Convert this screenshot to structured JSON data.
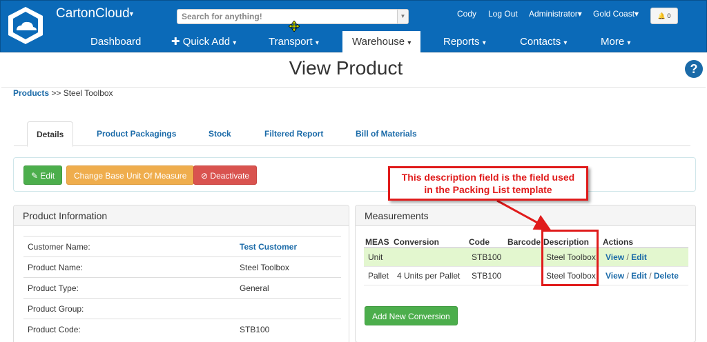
{
  "header": {
    "brand": "CartonCloud",
    "search_placeholder": "Search for anything!",
    "user": "Cody",
    "logout": "Log Out",
    "role": "Administrator",
    "location": "Gold Coast",
    "notifications": "0"
  },
  "nav": {
    "dashboard": "Dashboard",
    "quick_add": "Quick Add",
    "transport": "Transport",
    "warehouse": "Warehouse",
    "reports": "Reports",
    "contacts": "Contacts",
    "more": "More"
  },
  "page": {
    "title": "View Product",
    "breadcrumb_root": "Products",
    "breadcrumb_sep": ">>",
    "breadcrumb_current": "Steel Toolbox"
  },
  "tabs": {
    "details": "Details",
    "packagings": "Product Packagings",
    "stock": "Stock",
    "filtered": "Filtered Report",
    "bom": "Bill of Materials"
  },
  "actions": {
    "edit": "Edit",
    "change_uom": "Change Base Unit Of Measure",
    "deactivate": "Deactivate"
  },
  "callout": {
    "line1": "This description field is the field used",
    "line2": "in the Packing List template"
  },
  "product_info": {
    "heading": "Product Information",
    "rows": [
      {
        "label": "Customer Name:",
        "value": "Test Customer"
      },
      {
        "label": "Product Name:",
        "value": "Steel Toolbox"
      },
      {
        "label": "Product Type:",
        "value": "General"
      },
      {
        "label": "Product Group:",
        "value": ""
      },
      {
        "label": "Product Code:",
        "value": "STB100"
      }
    ]
  },
  "measurements": {
    "heading": "Measurements",
    "columns": [
      "MEAS",
      "Conversion",
      "Code",
      "Barcode",
      "Description",
      "Actions"
    ],
    "rows": [
      {
        "meas": "Unit",
        "conversion": "",
        "code": "STB100",
        "barcode": "",
        "description": "Steel Toolbox",
        "view": "View",
        "edit": "Edit"
      },
      {
        "meas": "Pallet",
        "conversion": "4 Units per Pallet",
        "code": "STB100",
        "barcode": "",
        "description": "Steel Toolbox",
        "view": "View",
        "edit": "Edit",
        "delete": "Delete"
      }
    ],
    "action_sep": "/",
    "add_button": "Add New Conversion"
  },
  "colors": {
    "brand_blue": "#0b6ab8",
    "link": "#1a6aa8",
    "success": "#4cae4c",
    "warning": "#efad4d",
    "danger": "#d9534f",
    "highlight_row": "#e3f7cf",
    "annotation_red": "#e01b1b"
  }
}
